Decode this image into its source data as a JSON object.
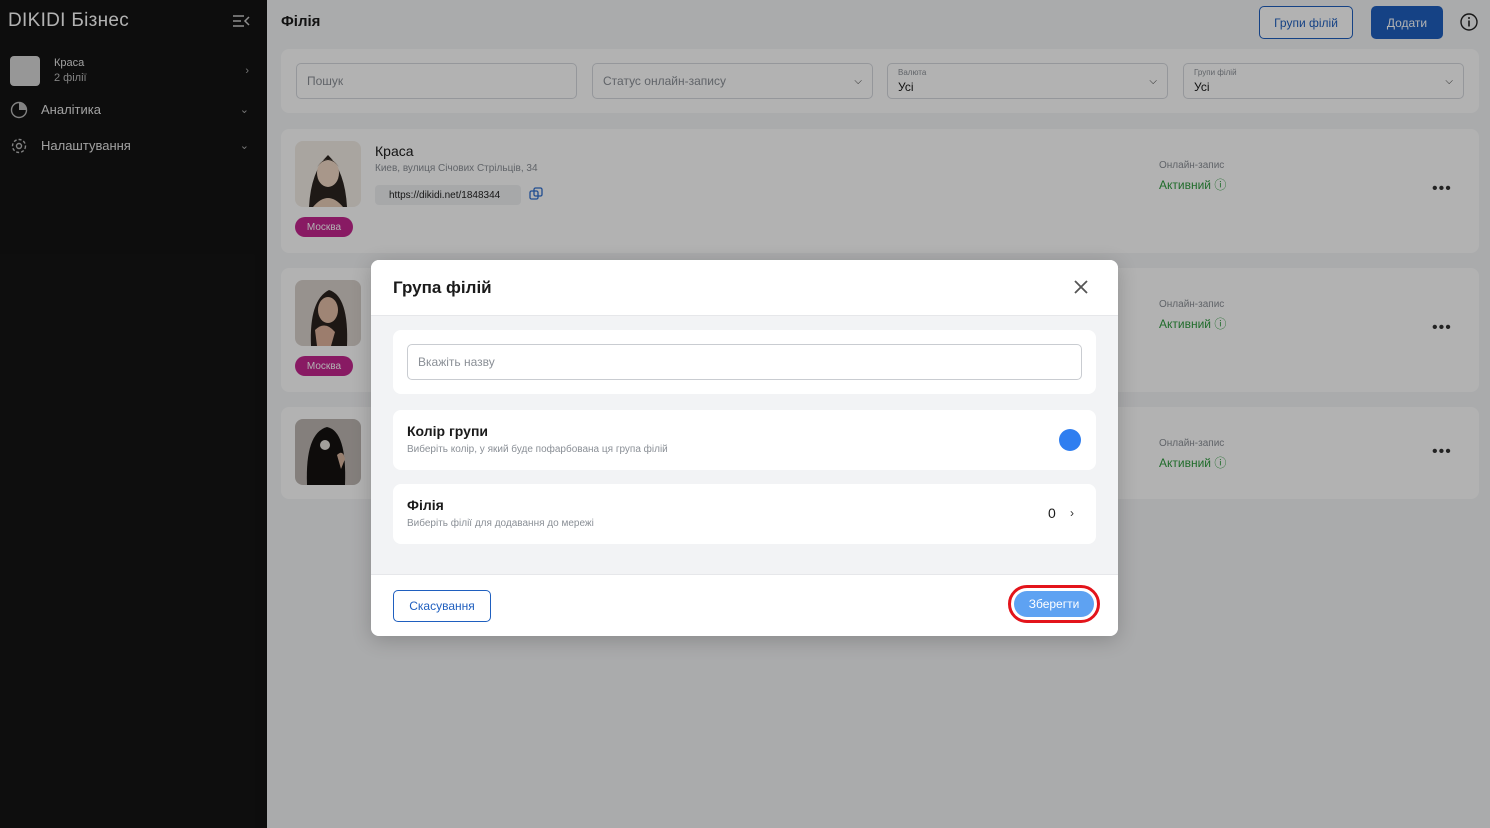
{
  "sidebar": {
    "brand": "DIKIDI Бізнес",
    "account": {
      "name": "Краса",
      "sub": "2 філії"
    },
    "items": [
      {
        "label": "Аналітика",
        "icon": "pie-chart-icon"
      },
      {
        "label": "Налаштування",
        "icon": "gear-icon"
      }
    ]
  },
  "header": {
    "title": "Філія",
    "groups_button": "Групи філій",
    "add_button": "Додати"
  },
  "filters": {
    "search_placeholder": "Пошук",
    "status_placeholder": "Статус онлайн-запису",
    "currency_label": "Валюта",
    "currency_value": "Усі",
    "groups_label": "Групи філій",
    "groups_value": "Усі"
  },
  "cards": [
    {
      "title": "Краса",
      "address": "Киев, вулиця Січових Стрільців, 34",
      "link": "https://dikidi.net/1848344",
      "tag": "Москва",
      "online_label": "Онлайн-запис",
      "online_value": "Активний"
    },
    {
      "tag": "Москва",
      "online_label": "Онлайн-запис",
      "online_value": "Активний"
    },
    {
      "online_label": "Онлайн-запис",
      "online_value": "Активний"
    }
  ],
  "modal": {
    "title": "Група філій",
    "name_placeholder": "Вкажіть назву",
    "color": {
      "title": "Колір групи",
      "subtitle": "Виберіть колір, у який буде пофарбована ця група філій",
      "value": "#2f7ef0"
    },
    "branch": {
      "title": "Філія",
      "subtitle": "Виберіть філії для додавання до мережі",
      "count": "0"
    },
    "cancel": "Скасування",
    "save": "Зберегти"
  }
}
